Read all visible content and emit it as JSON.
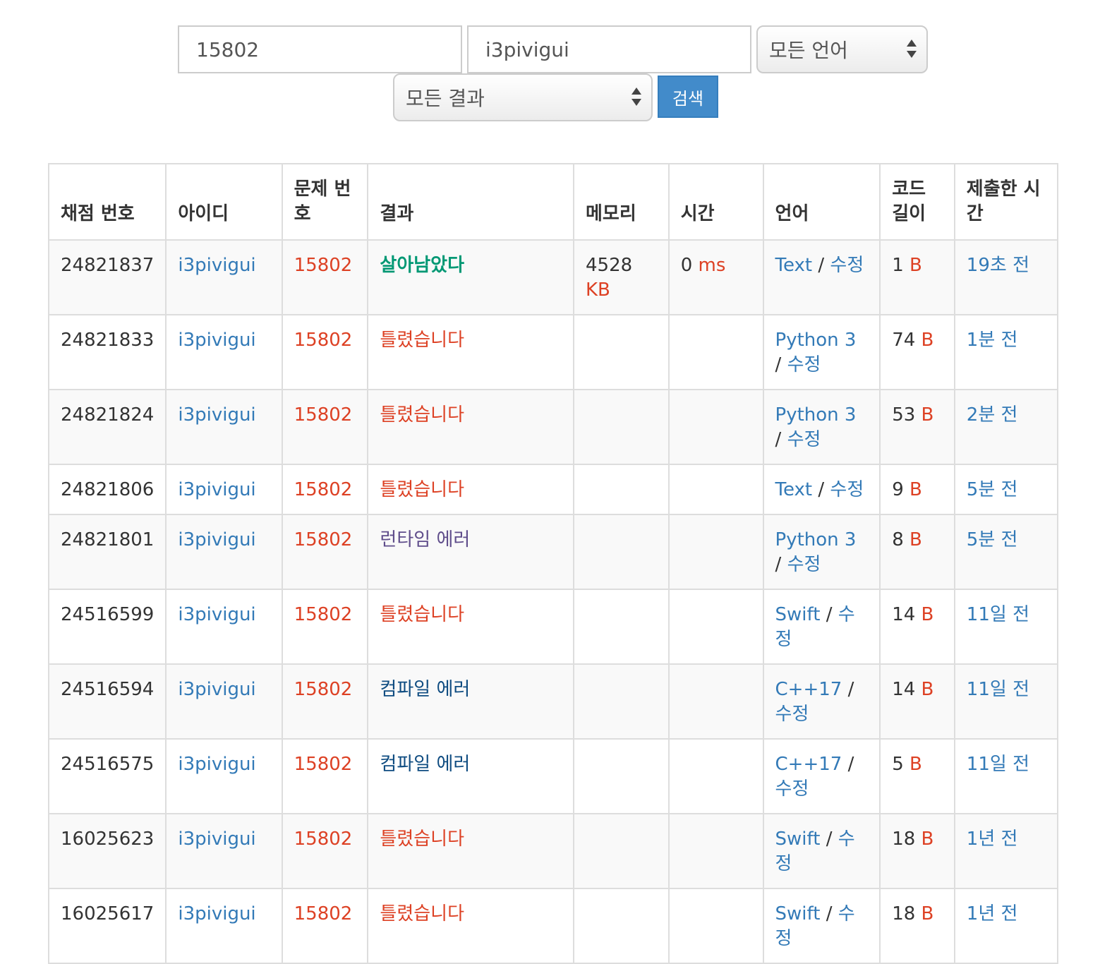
{
  "search": {
    "problem_id": "15802",
    "user_id": "i3pivigui",
    "language_select": "모든 언어",
    "result_select": "모든 결과",
    "search_button": "검색"
  },
  "table": {
    "headers": {
      "submission": "채점 번호",
      "user": "아이디",
      "problem": "문제 번호",
      "result": "결과",
      "memory": "메모리",
      "time": "시간",
      "language": "언어",
      "code_length": "코드 길이",
      "submitted": "제출한 시간"
    },
    "edit_label": "수정",
    "slash": "/",
    "rows": [
      {
        "id": "24821837",
        "user": "i3pivigui",
        "problem": "15802",
        "result": "살아남았다",
        "result_type": "green",
        "memory": "4528",
        "memory_unit": "KB",
        "time": "0",
        "time_unit": "ms",
        "lang": "Text",
        "length": "1",
        "length_unit": "B",
        "when": "19초 전"
      },
      {
        "id": "24821833",
        "user": "i3pivigui",
        "problem": "15802",
        "result": "틀렸습니다",
        "result_type": "red",
        "memory": "",
        "memory_unit": "",
        "time": "",
        "time_unit": "",
        "lang": "Python 3",
        "length": "74",
        "length_unit": "B",
        "when": "1분 전"
      },
      {
        "id": "24821824",
        "user": "i3pivigui",
        "problem": "15802",
        "result": "틀렸습니다",
        "result_type": "red",
        "memory": "",
        "memory_unit": "",
        "time": "",
        "time_unit": "",
        "lang": "Python 3",
        "length": "53",
        "length_unit": "B",
        "when": "2분 전"
      },
      {
        "id": "24821806",
        "user": "i3pivigui",
        "problem": "15802",
        "result": "틀렸습니다",
        "result_type": "red",
        "memory": "",
        "memory_unit": "",
        "time": "",
        "time_unit": "",
        "lang": "Text",
        "length": "9",
        "length_unit": "B",
        "when": "5분 전"
      },
      {
        "id": "24821801",
        "user": "i3pivigui",
        "problem": "15802",
        "result": "런타임 에러",
        "result_type": "purple",
        "memory": "",
        "memory_unit": "",
        "time": "",
        "time_unit": "",
        "lang": "Python 3",
        "length": "8",
        "length_unit": "B",
        "when": "5분 전"
      },
      {
        "id": "24516599",
        "user": "i3pivigui",
        "problem": "15802",
        "result": "틀렸습니다",
        "result_type": "red",
        "memory": "",
        "memory_unit": "",
        "time": "",
        "time_unit": "",
        "lang": "Swift",
        "length": "14",
        "length_unit": "B",
        "when": "11일 전"
      },
      {
        "id": "24516594",
        "user": "i3pivigui",
        "problem": "15802",
        "result": "컴파일 에러",
        "result_type": "navy",
        "memory": "",
        "memory_unit": "",
        "time": "",
        "time_unit": "",
        "lang": "C++17",
        "length": "14",
        "length_unit": "B",
        "when": "11일 전"
      },
      {
        "id": "24516575",
        "user": "i3pivigui",
        "problem": "15802",
        "result": "컴파일 에러",
        "result_type": "navy",
        "memory": "",
        "memory_unit": "",
        "time": "",
        "time_unit": "",
        "lang": "C++17",
        "length": "5",
        "length_unit": "B",
        "when": "11일 전"
      },
      {
        "id": "16025623",
        "user": "i3pivigui",
        "problem": "15802",
        "result": "틀렸습니다",
        "result_type": "red",
        "memory": "",
        "memory_unit": "",
        "time": "",
        "time_unit": "",
        "lang": "Swift",
        "length": "18",
        "length_unit": "B",
        "when": "1년 전"
      },
      {
        "id": "16025617",
        "user": "i3pivigui",
        "problem": "15802",
        "result": "틀렸습니다",
        "result_type": "red",
        "memory": "",
        "memory_unit": "",
        "time": "",
        "time_unit": "",
        "lang": "Swift",
        "length": "18",
        "length_unit": "B",
        "when": "1년 전"
      }
    ]
  }
}
